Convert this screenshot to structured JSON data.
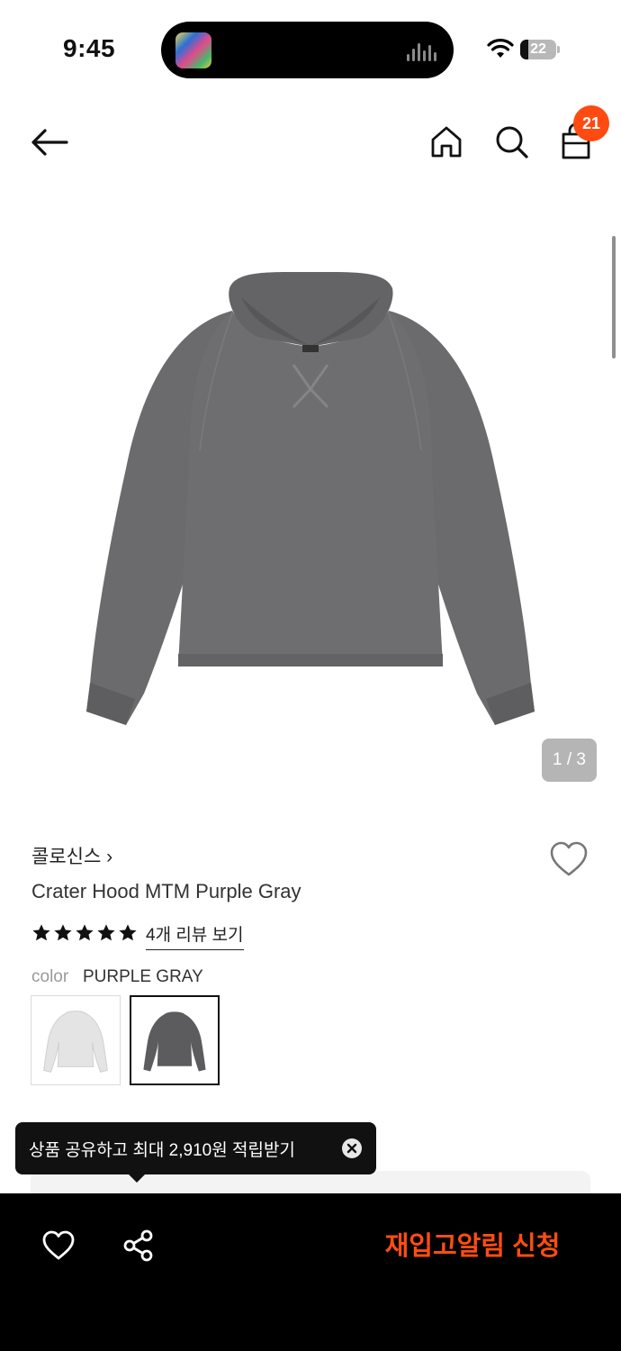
{
  "status_bar": {
    "time": "9:45",
    "battery": 22
  },
  "header": {
    "cart_count": "21"
  },
  "gallery": {
    "page_indicator": "1 / 3"
  },
  "product": {
    "brand": "콜로신스 ›",
    "name": "Crater Hood MTM Purple Gray",
    "rating": 5,
    "review_link": "4개 리뷰 보기",
    "color_label": "color",
    "color_value": "PURPLE GRAY",
    "swatch_colors": [
      "#e4e4e4",
      "#5c5c5e"
    ],
    "selected_swatch": 1
  },
  "colors": {
    "accent": "#ff4a12",
    "garment": "#6b6b6d"
  },
  "tooltip": {
    "text": "상품 공유하고 최대 2,910원 적립받기"
  },
  "bottom_bar": {
    "restock_label": "재입고알림 신청"
  }
}
